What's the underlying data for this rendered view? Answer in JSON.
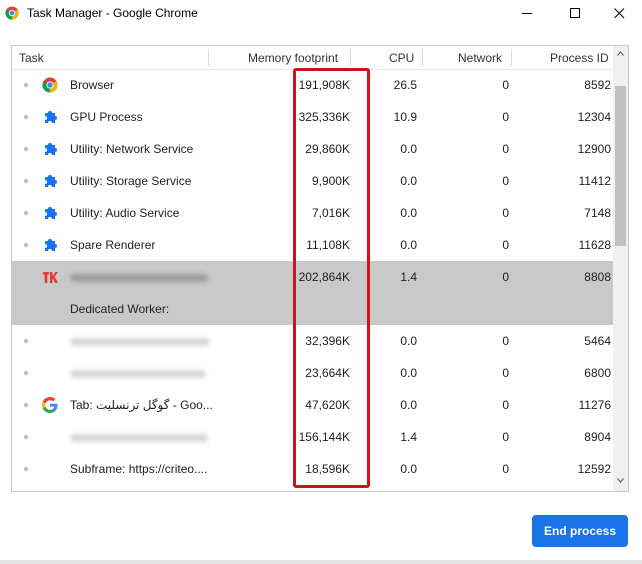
{
  "window": {
    "title": "Task Manager - Google Chrome",
    "controls": [
      "minimize-icon",
      "maximize-icon",
      "close-icon"
    ]
  },
  "table": {
    "columns": {
      "task": "Task",
      "memory": "Memory footprint",
      "cpu": "CPU",
      "network": "Network",
      "pid": "Process ID"
    },
    "rows": [
      {
        "icon": "chrome-icon",
        "task": "Browser",
        "memory": "191,908K",
        "cpu": "26.5",
        "network": "0",
        "pid": "8592"
      },
      {
        "icon": "puzzle-icon",
        "task": "GPU Process",
        "memory": "325,336K",
        "cpu": "10.9",
        "network": "0",
        "pid": "12304"
      },
      {
        "icon": "puzzle-icon",
        "task": "Utility: Network Service",
        "memory": "29,860K",
        "cpu": "0.0",
        "network": "0",
        "pid": "12900"
      },
      {
        "icon": "puzzle-icon",
        "task": "Utility: Storage Service",
        "memory": "9,900K",
        "cpu": "0.0",
        "network": "0",
        "pid": "11412"
      },
      {
        "icon": "puzzle-icon",
        "task": "Utility: Audio Service",
        "memory": "7,016K",
        "cpu": "0.0",
        "network": "0",
        "pid": "7148"
      },
      {
        "icon": "puzzle-icon",
        "task": "Spare Renderer",
        "memory": "11,108K",
        "cpu": "0.0",
        "network": "0",
        "pid": "11628"
      },
      {
        "icon": "site-favicon-icon",
        "task": "",
        "memory": "202,864K",
        "cpu": "1.4",
        "network": "0",
        "pid": "8808",
        "selected": true
      },
      {
        "icon": "",
        "task": "Dedicated Worker:",
        "memory": "",
        "cpu": "",
        "network": "",
        "pid": "",
        "selected": true
      },
      {
        "icon": "",
        "task": "",
        "memory": "32,396K",
        "cpu": "0.0",
        "network": "0",
        "pid": "5464"
      },
      {
        "icon": "",
        "task": "",
        "memory": "23,664K",
        "cpu": "0.0",
        "network": "0",
        "pid": "6800"
      },
      {
        "icon": "google-icon",
        "task": "Tab: گوگل ترنسلیت - Goo...",
        "memory": "47,620K",
        "cpu": "0.0",
        "network": "0",
        "pid": "11276"
      },
      {
        "icon": "",
        "task": "",
        "memory": "156,144K",
        "cpu": "1.4",
        "network": "0",
        "pid": "8904"
      },
      {
        "icon": "",
        "task": "Subframe: https://criteo....",
        "memory": "18,596K",
        "cpu": "0.0",
        "network": "0",
        "pid": "12592"
      }
    ]
  },
  "footer": {
    "end_process_label": "End process"
  },
  "colors": {
    "accent": "#1a73e8",
    "highlight_box": "#d0121b",
    "selected_row": "#c9c9c9"
  }
}
